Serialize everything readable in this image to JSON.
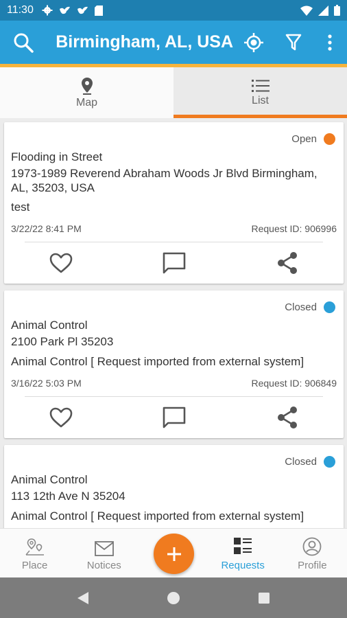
{
  "status_bar": {
    "time": "11:30",
    "left_icons": [
      "gear-icon",
      "bird-icon",
      "bird-icon",
      "sd-card-icon"
    ],
    "right_icons": [
      "wifi-icon",
      "cell-signal-icon",
      "battery-icon"
    ]
  },
  "app_bar": {
    "title": "Birmingham, AL, USA",
    "icons": [
      "search-icon",
      "locate-icon",
      "filter-icon",
      "overflow-menu-icon"
    ],
    "color": "#2a9fd8"
  },
  "tabs": [
    {
      "label": "Map",
      "icon": "map-pin-icon",
      "selected": false
    },
    {
      "label": "List",
      "icon": "list-icon",
      "selected": true
    }
  ],
  "requests": [
    {
      "status": "Open",
      "status_color": "#f07b1f",
      "category": "Flooding in Street",
      "address": "1973-1989 Reverend Abraham Woods Jr Blvd Birmingham, AL, 35203, USA",
      "description": "test",
      "date": "3/22/22 8:41 PM",
      "request_id": "Request ID: 906996"
    },
    {
      "status": "Closed",
      "status_color": "#2a9fd8",
      "category": "Animal Control",
      "address": "2100 Park Pl 35203",
      "description": "Animal Control [ Request imported from external system]",
      "date": "3/16/22 5:03 PM",
      "request_id": "Request ID: 906849"
    },
    {
      "status": "Closed",
      "status_color": "#2a9fd8",
      "category": "Animal Control",
      "address": "113 12th Ave N 35204",
      "description": "Animal Control [ Request imported from external system]"
    }
  ],
  "card_actions": [
    "heart-icon",
    "comment-icon",
    "share-icon"
  ],
  "bottom_nav": [
    {
      "label": "Place",
      "icon": "place-icon",
      "active": false
    },
    {
      "label": "Notices",
      "icon": "mail-icon",
      "active": false
    },
    {
      "label": "Requests",
      "icon": "requests-icon",
      "active": true
    },
    {
      "label": "Profile",
      "icon": "profile-icon",
      "active": false
    }
  ],
  "fab": {
    "label": "+",
    "color": "#f07b1f"
  },
  "system_nav": [
    "back-icon",
    "home-icon",
    "recents-icon"
  ]
}
